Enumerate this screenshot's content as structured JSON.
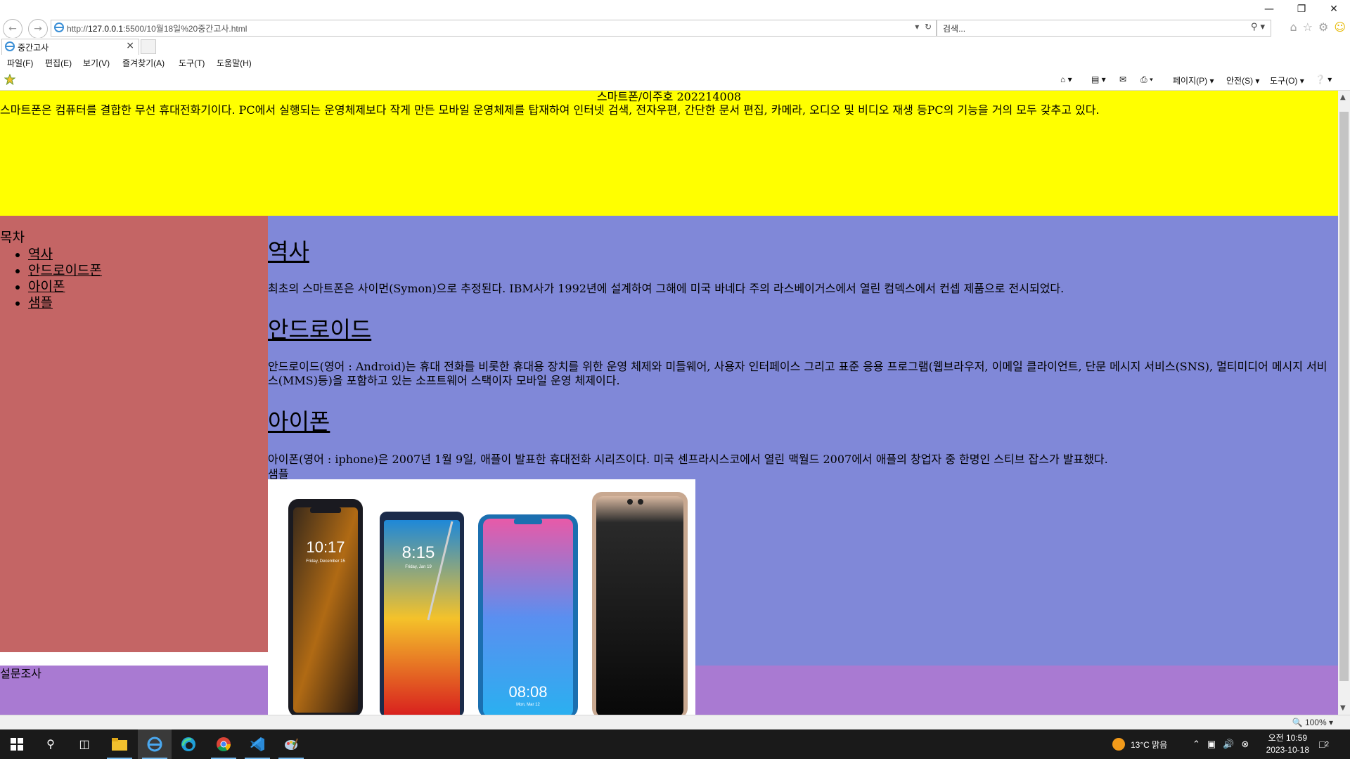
{
  "browser": {
    "url_prefix": "http://",
    "url_host": "127.0.0.1",
    "url_rest": ":5500/10월18일%20중간고사.html",
    "search_placeholder": "검색...",
    "tab_title": "중간고사",
    "menu": [
      "파일(F)",
      "편집(E)",
      "보기(V)",
      "즐겨찾기(A)",
      "도구(T)",
      "도움말(H)"
    ],
    "cmd": {
      "page": "페이지(P)",
      "safety": "안전(S)",
      "tools": "도구(O)"
    },
    "zoom": "100%"
  },
  "page": {
    "header_title": "스마트폰/이주호 202214008",
    "header_desc": "스마트폰은 컴퓨터를 결합한 무선 휴대전화기이다. PC에서 실행되는 운영체제보다 작게 만든 모바일 운영체제를 탑재하여 인터넷 검색, 전자우편, 간단한 문서 편집, 카메라, 오디오 및 비디오 재생 등PC의 기능을 거의 모두 갖추고 있다.",
    "toc_title": "목차",
    "toc_items": [
      "역사",
      "안드로이드폰",
      "아이폰",
      "샘플"
    ],
    "sections": [
      {
        "heading": "역사",
        "text": "최초의 스마트폰은 사이먼(Symon)으로 추정된다. IBM사가 1992년에 설계하여 그해에 미국 바네다 주의 라스베이거스에서 열린 컴덱스에서 컨셉 제품으로 전시되었다."
      },
      {
        "heading": "안드로이드",
        "text": "안드로이드(영어 : Android)는 휴대 전화를 비롯한 휴대용 장치를 위한 운영 체제와 미들웨어, 사용자 인터페이스 그리고 표준 응용 프로그램(웹브라우저, 이메일 클라이언트, 단문 메시지 서비스(SNS), 멀티미디어 메시지 서비스(MMS)등)을 포함하고 있는 소프트웨어 스택이자 모바일 운영 체제이다."
      },
      {
        "heading": "아이폰",
        "text": "아이폰(영어 : iphone)은 2007년 1월 9일, 애플이 발표한 휴대전화 시리즈이다. 미국 센프라시스코에서 열린 맥월드 2007에서 애플의 창업자 중 한명인 스티브 잡스가 발표했다."
      }
    ],
    "sample_label": "샘플",
    "phone_screens": [
      {
        "time": "10:17",
        "date": "Friday, December 15"
      },
      {
        "time": "8:15",
        "date": "Friday, Jan 19"
      },
      {
        "time": "08:08",
        "date": "Mon, Mar 12"
      },
      {
        "time": "",
        "date": ""
      }
    ],
    "survey_label": "설문조사"
  },
  "taskbar": {
    "weather": "13°C 맑음",
    "time": "오전 10:59",
    "date": "2023-10-18",
    "notifications": "2"
  },
  "colors": {
    "header_bg": "#ffff00",
    "toc_bg": "#c46565",
    "content_bg": "#8088d8",
    "survey_bg": "#a97ad2"
  }
}
